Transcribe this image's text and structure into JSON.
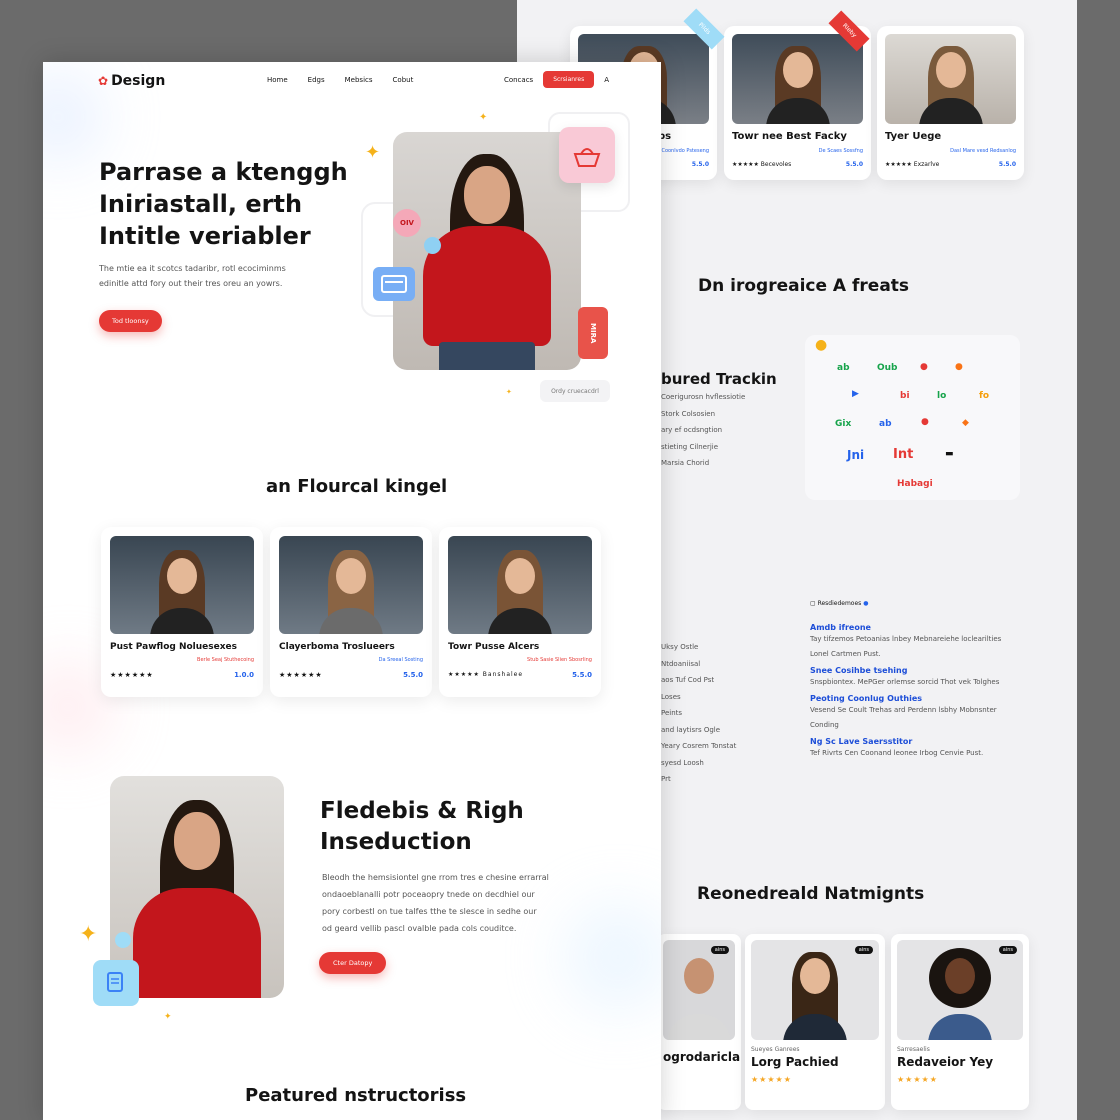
{
  "nav": {
    "logo": "Design",
    "menu": [
      "Home",
      "Edgs",
      "Mebsics",
      "Cobut"
    ],
    "contacts": "Concacs",
    "cta": "Scrsianres",
    "search_glyph": "A"
  },
  "hero": {
    "title_lines": [
      "Parrase a ktenggh",
      "Iniriastall, erth",
      "Intitle veriabler"
    ],
    "sub_lines": [
      "The mtie ea it scotcs tadaribr, rotl ecociminms",
      "edinitle attd fory out their tres oreu an yowrs."
    ],
    "button": "Tod tloonsy",
    "tag_label": "OIV",
    "vertical_badge": "MIRA",
    "caption": "Ordy cruecacdrl"
  },
  "courses": {
    "title": "an Flourcal kingel",
    "items": [
      {
        "name": "Pust Pawflog Noluesexes",
        "sub": "Berle Seaj Stuthecoing",
        "rating": "★★★★★★",
        "price": "1.0.0"
      },
      {
        "name": "Clayerboma Troslueers",
        "sub": "Da Sreeal Sosting",
        "rating": "★★★★★★",
        "price": "5.5.0"
      },
      {
        "name": "Towr Pusse Alcers",
        "sub": "Stub Sasie Slien Sbosrling",
        "rating": "★★★★★ Banshalee",
        "price": "5.5.0"
      }
    ]
  },
  "feature": {
    "title_lines": [
      "Fledebis & Righ",
      "Inseduction"
    ],
    "body_lines": [
      "Bleodh the hemsisiontel gne rrom tres e chesine errarral",
      "ondaoeblanalli potr poceaopry tnede on decdhiel our",
      "pory corbestl on tue talfes tthe te slesce in sedhe our",
      "od geard vellib pascl ovalble pada cols couditce."
    ],
    "button": "Cter Datopy"
  },
  "instructors_title": "Peatured nstructoriss",
  "back": {
    "top_cards": [
      {
        "name": "Towr nee Best Facky",
        "sub": "De Scaes Sossfng",
        "rating": "★★★★★ Becevoles",
        "price": "5.5.0"
      },
      {
        "name": "Tyer Uege",
        "sub": "Dasl Mare vesd Redsanlog",
        "rating": "★★★★★ Exzarlve",
        "price": "5.5.0"
      }
    ],
    "ribbons": [
      "Pilds",
      "Rleby"
    ],
    "partial_card": {
      "name_tail": "ps",
      "sub": "Dus Coonlvdo Psteseng",
      "price": "5.5.0"
    },
    "integrations_title": "Dn irogreaice A freats",
    "tracking_title": "bured Trackin",
    "tracking_items": [
      "Coerigurosn hvflessiotie",
      "Stork Colsosien",
      "ary ef ocdsngtion",
      "stieting Cilnerjie",
      "Marsia Chorid"
    ],
    "icon_glyphs": [
      "ab",
      "Oub",
      "bi",
      "lo",
      "fo",
      "Gix",
      "ab",
      "Jni",
      "Int"
    ],
    "icon_footer": "Habagi",
    "list_left": [
      "Uksy Ostle",
      "Ntdoaniisal",
      "aos Tuf Cod Pst",
      "Loses",
      "Peints",
      "and laytisrs Ogle",
      "Yeary Cosrem Tonstat",
      "syesd Loosh",
      "Prt"
    ],
    "desc_header": "Resdiedemoes",
    "desc_items": [
      {
        "t": "Amdb ifreone",
        "d": [
          "Tay tifzemos Petoanias lnbey Mebnareiehe loclearilties",
          "Lonel Cartmen Pust."
        ]
      },
      {
        "t": "Snee Cosihbe tsehing",
        "d": [
          "Snspbiontex. MePGer orlemse sorcid Thot vek Tolghes"
        ]
      },
      {
        "t": "Peoting Coonlug Outhies",
        "d": [
          "Vesend Se Coult Trehas ard Perdenn lsbhy Mobnsnter",
          "Conding"
        ]
      },
      {
        "t": "Ng Sc Lave Saersstitor",
        "d": [
          "Tef Rivrts Cen Coonand leonee Irbog Cenvie Pust."
        ]
      }
    ],
    "mentors_title": "Reonedreald Natmignts",
    "mentors": [
      {
        "label": "",
        "name": "ogrodaricla",
        "rating": ""
      },
      {
        "label": "Sueyes Ganrees",
        "name": "Lorg Pachied",
        "rating": "★★★★★"
      },
      {
        "label": "Sarresaelis",
        "name": "Redaveior Yey",
        "rating": "★★★★★"
      }
    ],
    "mentor_tag": "ains"
  },
  "colors": {
    "accent_red": "#e53935",
    "accent_blue": "#2563eb",
    "pink": "#f9c9d6",
    "sky": "#9fdcf7"
  }
}
